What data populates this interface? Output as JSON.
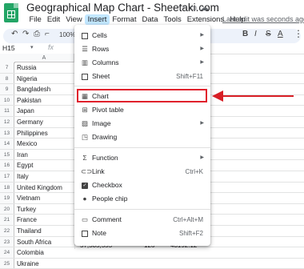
{
  "title": "Geographical Map Chart - Sheetaki.com",
  "menubar": [
    "File",
    "Edit",
    "View",
    "Insert",
    "Format",
    "Data",
    "Tools",
    "Extensions",
    "Help"
  ],
  "last_edit": "Last edit was seconds ago",
  "toolbar": {
    "zoom": "100%",
    "bold": "B",
    "italic": "I",
    "strike": "S",
    "text_color": "A"
  },
  "formula_bar": {
    "cell_ref": "H15",
    "fx": "fx"
  },
  "column_header": "A",
  "rows": [
    {
      "num": "7",
      "country": "Russia"
    },
    {
      "num": "8",
      "country": "Nigeria"
    },
    {
      "num": "9",
      "country": "Bangladesh"
    },
    {
      "num": "10",
      "country": "Pakistan"
    },
    {
      "num": "11",
      "country": "Japan"
    },
    {
      "num": "12",
      "country": "Germany"
    },
    {
      "num": "13",
      "country": "Philippines"
    },
    {
      "num": "14",
      "country": "Mexico"
    },
    {
      "num": "15",
      "country": "Iran"
    },
    {
      "num": "16",
      "country": "Egypt"
    },
    {
      "num": "17",
      "country": "Italy"
    },
    {
      "num": "18",
      "country": "United Kingdom"
    },
    {
      "num": "19",
      "country": "Vietnam"
    },
    {
      "num": "20",
      "country": "Turkey"
    },
    {
      "num": "21",
      "country": "France"
    },
    {
      "num": "22",
      "country": "Thailand"
    },
    {
      "num": "23",
      "country": "South Africa"
    },
    {
      "num": "24",
      "country": "Colombia"
    },
    {
      "num": "25",
      "country": "Ukraine"
    }
  ],
  "last_row_values": {
    "b": "57,505,555",
    "c": "126",
    "d": "43192.12"
  },
  "menu": {
    "cells": "Cells",
    "rows": "Rows",
    "columns": "Columns",
    "sheet": "Sheet",
    "sheet_shortcut": "Shift+F11",
    "chart": "Chart",
    "pivot_table": "Pivot table",
    "image": "Image",
    "drawing": "Drawing",
    "function": "Function",
    "link": "Link",
    "link_shortcut": "Ctrl+K",
    "checkbox": "Checkbox",
    "people_chip": "People chip",
    "comment": "Comment",
    "comment_shortcut": "Ctrl+Alt+M",
    "note": "Note",
    "note_shortcut": "Shift+F2"
  },
  "colors": {
    "highlight": "#e0212c",
    "menu_active": "#c2e7ff",
    "sheets_green": "#23a566"
  }
}
